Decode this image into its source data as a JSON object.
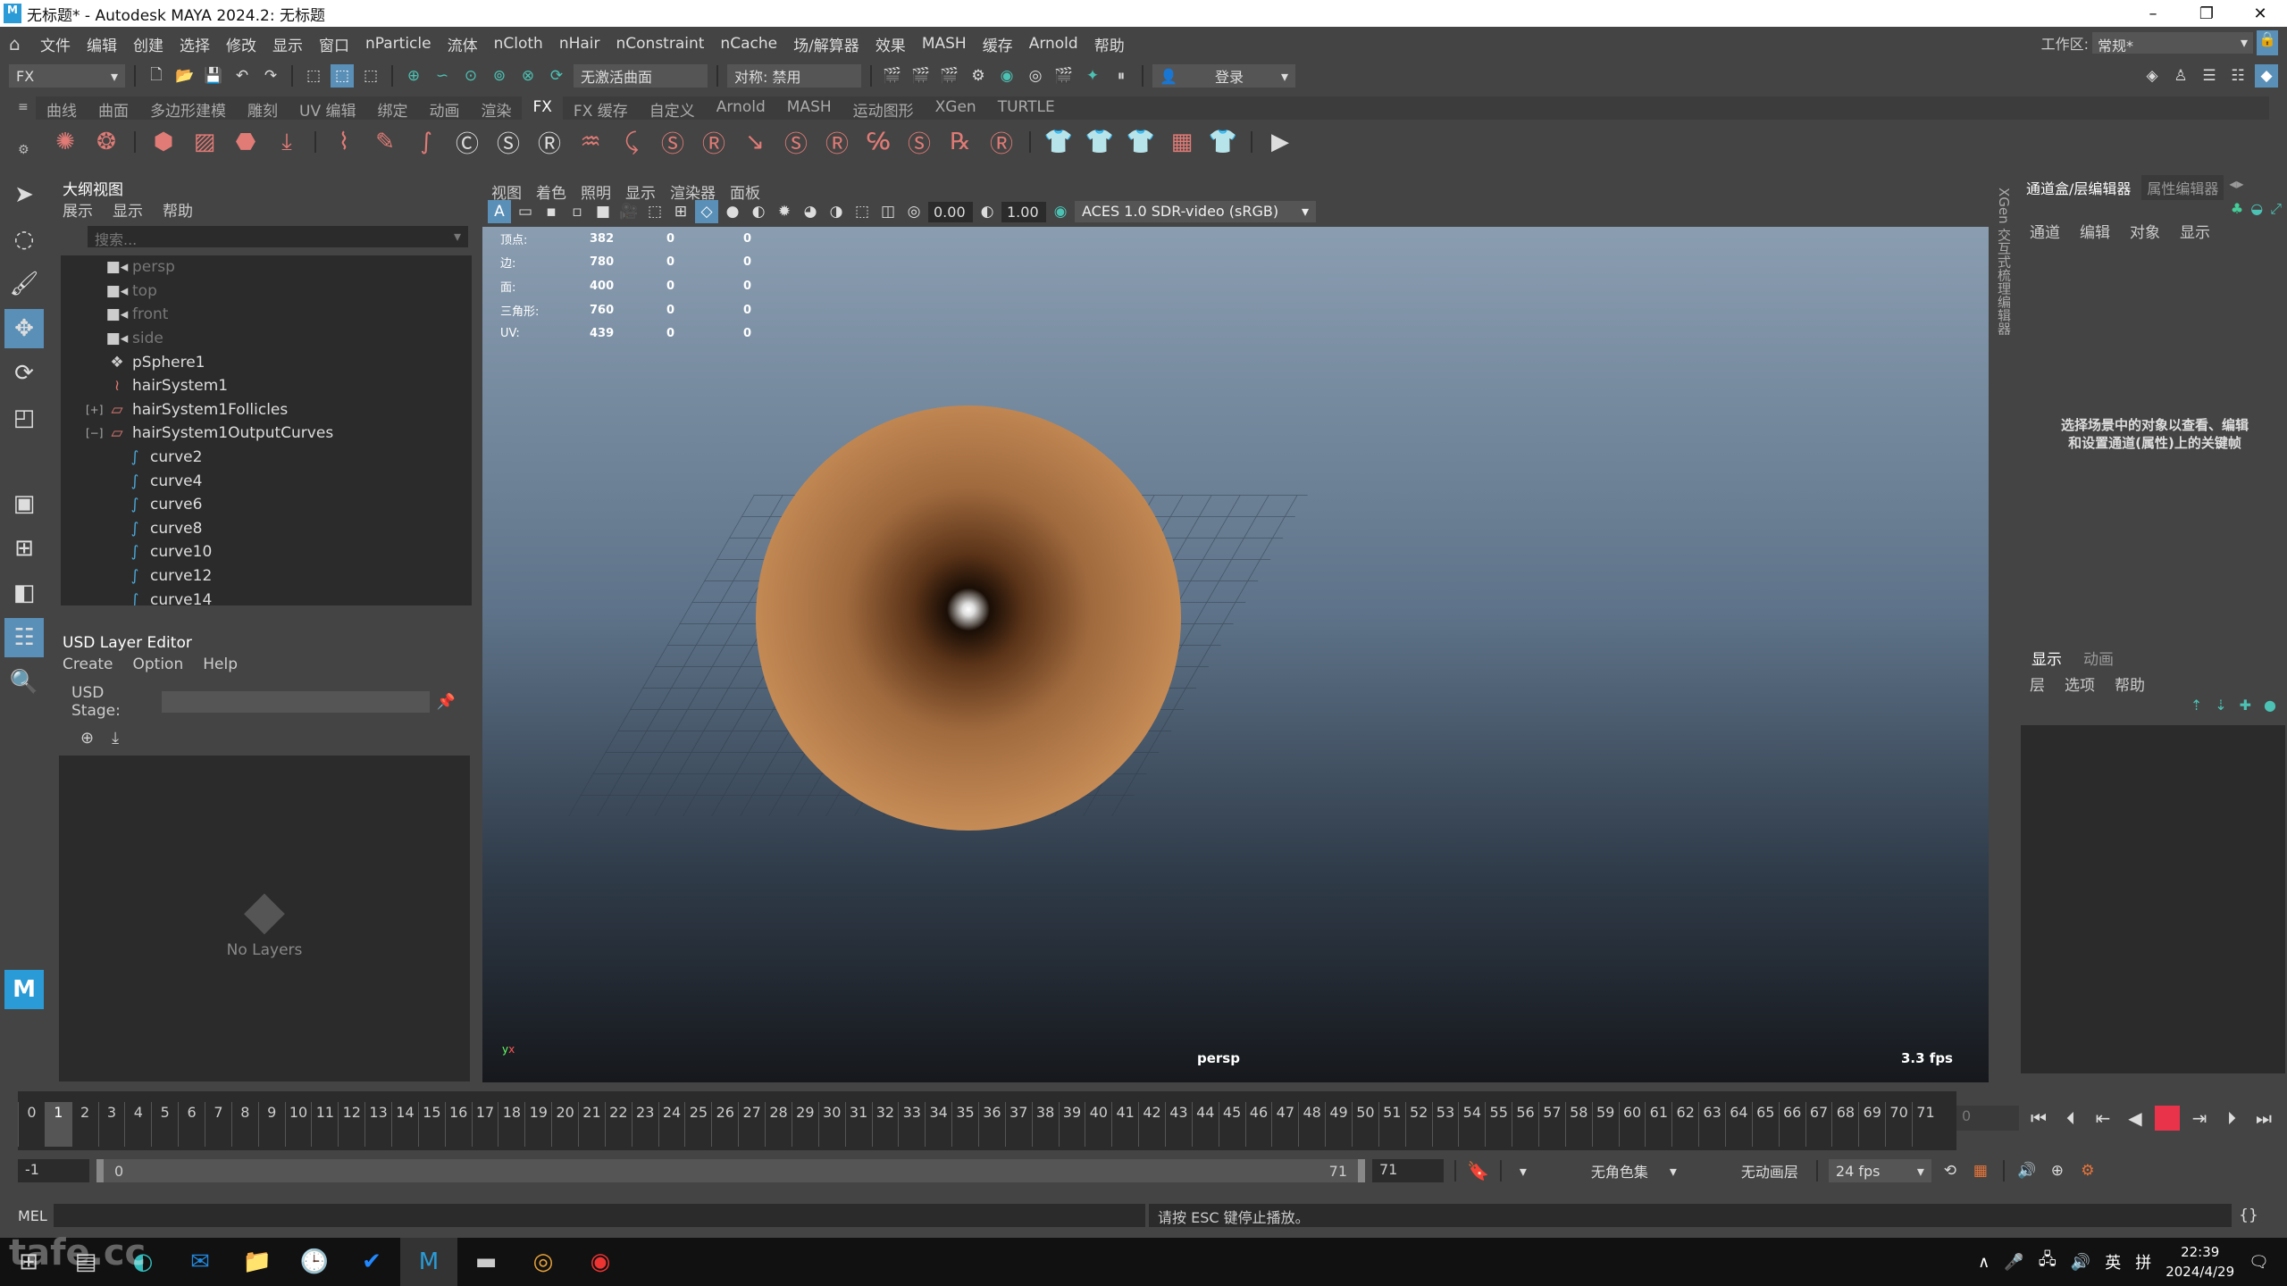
{
  "window": {
    "title": "无标题* - Autodesk MAYA 2024.2: 无标题",
    "buttons": [
      "–",
      "❐",
      "✕"
    ]
  },
  "menubar": {
    "items": [
      "文件",
      "编辑",
      "创建",
      "选择",
      "修改",
      "显示",
      "窗口",
      "nParticle",
      "流体",
      "nCloth",
      "nHair",
      "nConstraint",
      "nCache",
      "场/解算器",
      "效果",
      "MASH",
      "缓存",
      "Arnold",
      "帮助"
    ],
    "workspace_label": "工作区:",
    "workspace_value": "常规*"
  },
  "statusline": {
    "menuset": "FX",
    "live_surface": "无激活曲面",
    "symmetry": "对称: 禁用",
    "login": "登录"
  },
  "shelf": {
    "tabs": [
      "曲线",
      "曲面",
      "多边形建模",
      "雕刻",
      "UV 编辑",
      "绑定",
      "动画",
      "渲染",
      "FX",
      "FX 缓存",
      "自定义",
      "Arnold",
      "MASH",
      "运动图形",
      "XGen",
      "TURTLE"
    ],
    "active_tab": "FX"
  },
  "outliner": {
    "title": "大纲视图",
    "menus": [
      "展示",
      "显示",
      "帮助"
    ],
    "search_placeholder": "搜索...",
    "items": [
      {
        "label": "persp",
        "icon": "camera-icon",
        "dim": true
      },
      {
        "label": "top",
        "icon": "camera-icon",
        "dim": true
      },
      {
        "label": "front",
        "icon": "camera-icon",
        "dim": true
      },
      {
        "label": "side",
        "icon": "camera-icon",
        "dim": true
      },
      {
        "label": "pSphere1",
        "icon": "mesh-icon",
        "dim": false
      },
      {
        "label": "hairSystem1",
        "icon": "hair-system-icon",
        "dim": false
      },
      {
        "label": "hairSystem1Follicles",
        "icon": "group-icon",
        "dim": false,
        "expander": "+"
      },
      {
        "label": "hairSystem1OutputCurves",
        "icon": "group-icon",
        "dim": false,
        "expander": "−"
      },
      {
        "label": "curve2",
        "icon": "curve-icon",
        "child": true
      },
      {
        "label": "curve4",
        "icon": "curve-icon",
        "child": true
      },
      {
        "label": "curve6",
        "icon": "curve-icon",
        "child": true
      },
      {
        "label": "curve8",
        "icon": "curve-icon",
        "child": true
      },
      {
        "label": "curve10",
        "icon": "curve-icon",
        "child": true
      },
      {
        "label": "curve12",
        "icon": "curve-icon",
        "child": true
      },
      {
        "label": "curve14",
        "icon": "curve-icon",
        "child": true
      }
    ]
  },
  "usd": {
    "title": "USD Layer Editor",
    "menus": [
      "Create",
      "Option",
      "Help"
    ],
    "stage_label": "USD Stage:",
    "empty": "No Layers"
  },
  "viewport": {
    "menus": [
      "视图",
      "着色",
      "照明",
      "显示",
      "渲染器",
      "面板"
    ],
    "exposure": "0.00",
    "gamma": "1.00",
    "color_space": "ACES 1.0 SDR-video (sRGB)",
    "hud": [
      {
        "label": "顶点:",
        "values": [
          "382",
          "0",
          "0"
        ]
      },
      {
        "label": "边:",
        "values": [
          "780",
          "0",
          "0"
        ]
      },
      {
        "label": "面:",
        "values": [
          "400",
          "0",
          "0"
        ]
      },
      {
        "label": "三角形:",
        "values": [
          "760",
          "0",
          "0"
        ]
      },
      {
        "label": "UV:",
        "values": [
          "439",
          "0",
          "0"
        ]
      }
    ],
    "camera": "persp",
    "fps": "3.3 fps"
  },
  "channel_box": {
    "tabs": [
      "通道盒/层编辑器",
      "属性编辑器"
    ],
    "menus": [
      "通道",
      "编辑",
      "对象",
      "显示"
    ],
    "hint": "选择场景中的对象以查看、编辑和设置通道(属性)上的关键帧",
    "xgen_tab": "XGen 交互式梳理编辑器"
  },
  "layer_editor": {
    "tabs": [
      "显示",
      "动画"
    ],
    "menus": [
      "层",
      "选项",
      "帮助"
    ]
  },
  "timeline": {
    "start": 0,
    "end": 71,
    "current_frame": "1",
    "current_field": "0"
  },
  "range": {
    "anim_start": "-1",
    "start": "0",
    "end": "71",
    "anim_end": "71",
    "character_set": "无角色集",
    "anim_layer": "无动画层",
    "fps": "24 fps"
  },
  "cmdline": {
    "label": "MEL",
    "feedback": "请按 ESC 键停止播放。"
  },
  "taskbar": {
    "apps": [
      "windows-start",
      "task-view",
      "edge",
      "outlook",
      "file-explorer",
      "clock-app",
      "todo",
      "maya",
      "terminal",
      "app-spiral",
      "obs"
    ],
    "tray_lang": "英",
    "tray_ime": "拼",
    "time": "22:39",
    "date": "2024/4/29"
  },
  "watermark": "tafe.cc"
}
